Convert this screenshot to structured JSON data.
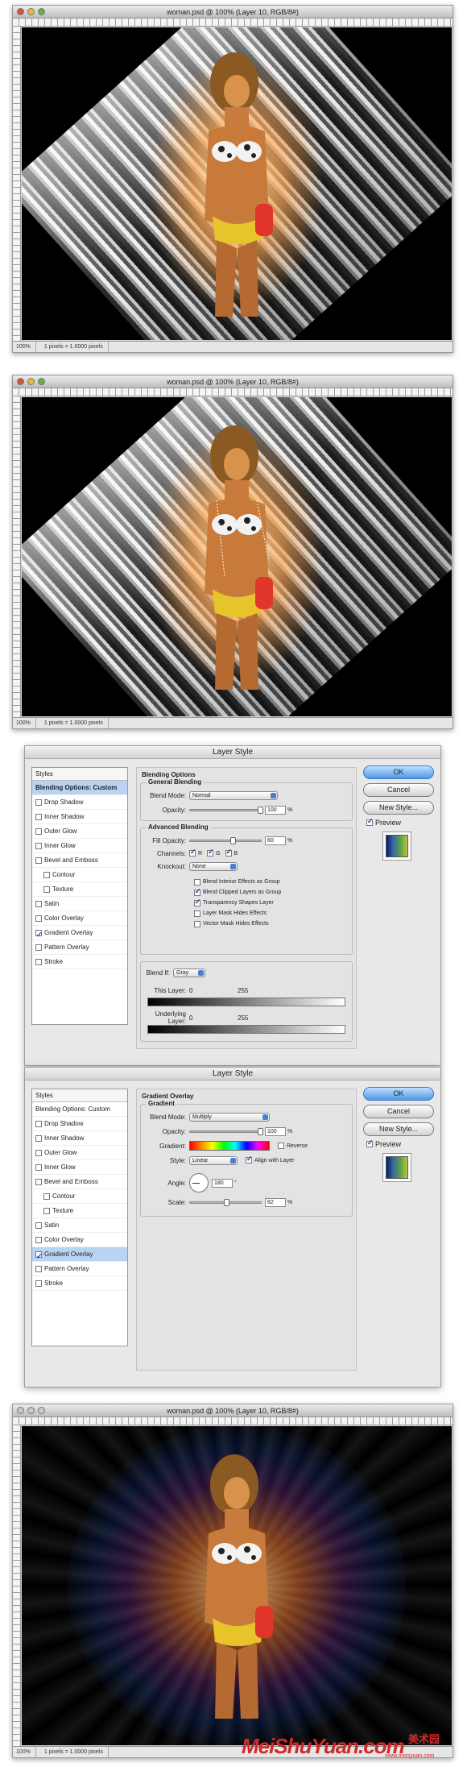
{
  "document": {
    "title": "woman.psd @ 100% (Layer 10, RGB/8#)",
    "zoom": "100%",
    "doc_info": "1 pixels = 1.0000 pixels"
  },
  "dialog_blending": {
    "title": "Layer Style",
    "styles_header": "Styles",
    "styles": [
      {
        "label": "Blending Options: Custom",
        "checked": false,
        "indent": false,
        "selected": true
      },
      {
        "label": "Drop Shadow",
        "checked": false,
        "indent": false
      },
      {
        "label": "Inner Shadow",
        "checked": false,
        "indent": false
      },
      {
        "label": "Outer Glow",
        "checked": false,
        "indent": false
      },
      {
        "label": "Inner Glow",
        "checked": false,
        "indent": false
      },
      {
        "label": "Bevel and Emboss",
        "checked": false,
        "indent": false
      },
      {
        "label": "Contour",
        "checked": false,
        "indent": true
      },
      {
        "label": "Texture",
        "checked": false,
        "indent": true
      },
      {
        "label": "Satin",
        "checked": false,
        "indent": false
      },
      {
        "label": "Color Overlay",
        "checked": false,
        "indent": false
      },
      {
        "label": "Gradient Overlay",
        "checked": true,
        "indent": false
      },
      {
        "label": "Pattern Overlay",
        "checked": false,
        "indent": false
      },
      {
        "label": "Stroke",
        "checked": false,
        "indent": false
      }
    ],
    "section_title": "Blending Options",
    "general_title": "General Blending",
    "blend_mode_label": "Blend Mode:",
    "blend_mode": "Normal",
    "opacity_label": "Opacity:",
    "opacity": "100",
    "advanced_title": "Advanced Blending",
    "fill_opacity_label": "Fill Opacity:",
    "fill_opacity": "60",
    "channels_label": "Channels:",
    "channel_r": "R",
    "channel_g": "G",
    "channel_b": "B",
    "knockout_label": "Knockout:",
    "knockout": "None",
    "checks": [
      {
        "label": "Blend Interior Effects as Group",
        "checked": false
      },
      {
        "label": "Blend Clipped Layers as Group",
        "checked": true
      },
      {
        "label": "Transparency Shapes Layer",
        "checked": true
      },
      {
        "label": "Layer Mask Hides Effects",
        "checked": false
      },
      {
        "label": "Vector Mask Hides Effects",
        "checked": false
      }
    ],
    "blend_if_label": "Blend If:",
    "blend_if": "Gray",
    "this_layer_label": "This Layer:",
    "this_layer_min": "0",
    "this_layer_max": "255",
    "underlying_label": "Underlying Layer:",
    "underlying_min": "0",
    "underlying_max": "255",
    "percent": "%"
  },
  "dialog_gradient": {
    "title": "Layer Style",
    "styles_header": "Styles",
    "styles": [
      {
        "label": "Blending Options: Custom",
        "checked": false,
        "indent": false
      },
      {
        "label": "Drop Shadow",
        "checked": false,
        "indent": false
      },
      {
        "label": "Inner Shadow",
        "checked": false,
        "indent": false
      },
      {
        "label": "Outer Glow",
        "checked": false,
        "indent": false
      },
      {
        "label": "Inner Glow",
        "checked": false,
        "indent": false
      },
      {
        "label": "Bevel and Emboss",
        "checked": false,
        "indent": false
      },
      {
        "label": "Contour",
        "checked": false,
        "indent": true
      },
      {
        "label": "Texture",
        "checked": false,
        "indent": true
      },
      {
        "label": "Satin",
        "checked": false,
        "indent": false
      },
      {
        "label": "Color Overlay",
        "checked": false,
        "indent": false
      },
      {
        "label": "Gradient Overlay",
        "checked": true,
        "indent": false,
        "selected": true
      },
      {
        "label": "Pattern Overlay",
        "checked": false,
        "indent": false
      },
      {
        "label": "Stroke",
        "checked": false,
        "indent": false
      }
    ],
    "section_title": "Gradient Overlay",
    "gradient_title": "Gradient",
    "blend_mode_label": "Blend Mode:",
    "blend_mode": "Multiply",
    "opacity_label": "Opacity:",
    "opacity": "100",
    "gradient_label": "Gradient:",
    "reverse_label": "Reverse",
    "style_label": "Style:",
    "style": "Linear",
    "align_label": "Align with Layer",
    "angle_label": "Angle:",
    "angle": "180",
    "degree": "°",
    "scale_label": "Scale:",
    "scale": "82",
    "percent": "%"
  },
  "buttons": {
    "ok": "OK",
    "cancel": "Cancel",
    "new_style": "New Style...",
    "preview": "Preview"
  },
  "watermark": {
    "brand": "MeiShuYuan.com",
    "chinese": "美术园",
    "url": "www.missyuan.com"
  },
  "colors": {
    "ok_button": "#4f98e6",
    "selection": "#b9d3f2",
    "watermark": "#cf2a2a"
  }
}
